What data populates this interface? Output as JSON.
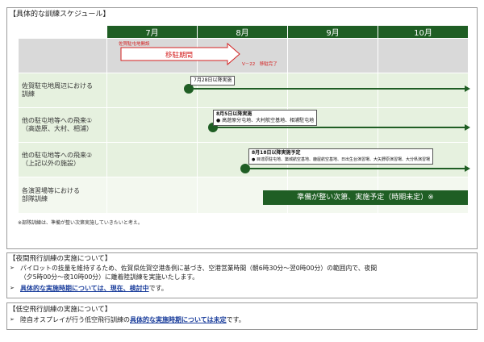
{
  "schedule": {
    "title": "【具体的な訓練スケジュール】",
    "months": [
      "7月",
      "8月",
      "9月",
      "10月"
    ],
    "rows": [
      {
        "label": ""
      },
      {
        "label": "佐賀駐屯地周辺における\n訓練"
      },
      {
        "label": "他の駐屯地等への飛来①\n（高遊原、大村、相浦）"
      },
      {
        "label": "他の駐屯地等への飛来②\n（上記以外の施設）"
      },
      {
        "label": "各演習場等における\n部隊訓練"
      }
    ],
    "deploy": {
      "small_label": "佐賀駐屯地開設",
      "period_label": "移駐期間",
      "complete_label": "V－22　移駐完了"
    },
    "callouts": {
      "row1": "7月28日以降実施",
      "row2_title": "8月5日以降実施",
      "row2_detail": "● 高遊原分屯地、大村航空基地、相浦駐屯地",
      "row3_title": "8月18日以降実施予定",
      "row3_detail": "● 目達原駐屯地、築城航空基地、鹿屋航空基地、日出生台演習場、大矢野原演習場、大分県演習場"
    },
    "prep_label": "準備が整い次第、実施予定（時期未定）※",
    "footnote": "※部隊訓練は、準備が整い次第実施していきたいと考え。"
  },
  "night": {
    "title": "【夜間飛行訓練の実施について】",
    "bullet1_line1": "パイロットの技量を維持するため、佐賀県佐賀空港条例に基づき、空港営業時間（朝6時30分～翌0時00分）の範囲内で、夜間",
    "bullet1_line2": "（夕5時00分～夜10時00分）に離着陸訓練を実施いたします。",
    "bullet2_link": "具体的な実施時期については、現在、検討中",
    "bullet2_suffix": "です。"
  },
  "low": {
    "title": "【低空飛行訓練の実施について】",
    "bullet_prefix": "陸自オスプレイが行う低空飛行訓練の",
    "bullet_link": "具体的な実施時期については未定",
    "bullet_suffix": "です。"
  },
  "bullet_mark": "➢",
  "colors": {
    "dark_green": "#1f5e24",
    "light_green": "#e6f1df",
    "gray": "#d9d9d9",
    "red": "#d42020",
    "link_blue": "#1b3e9c"
  }
}
